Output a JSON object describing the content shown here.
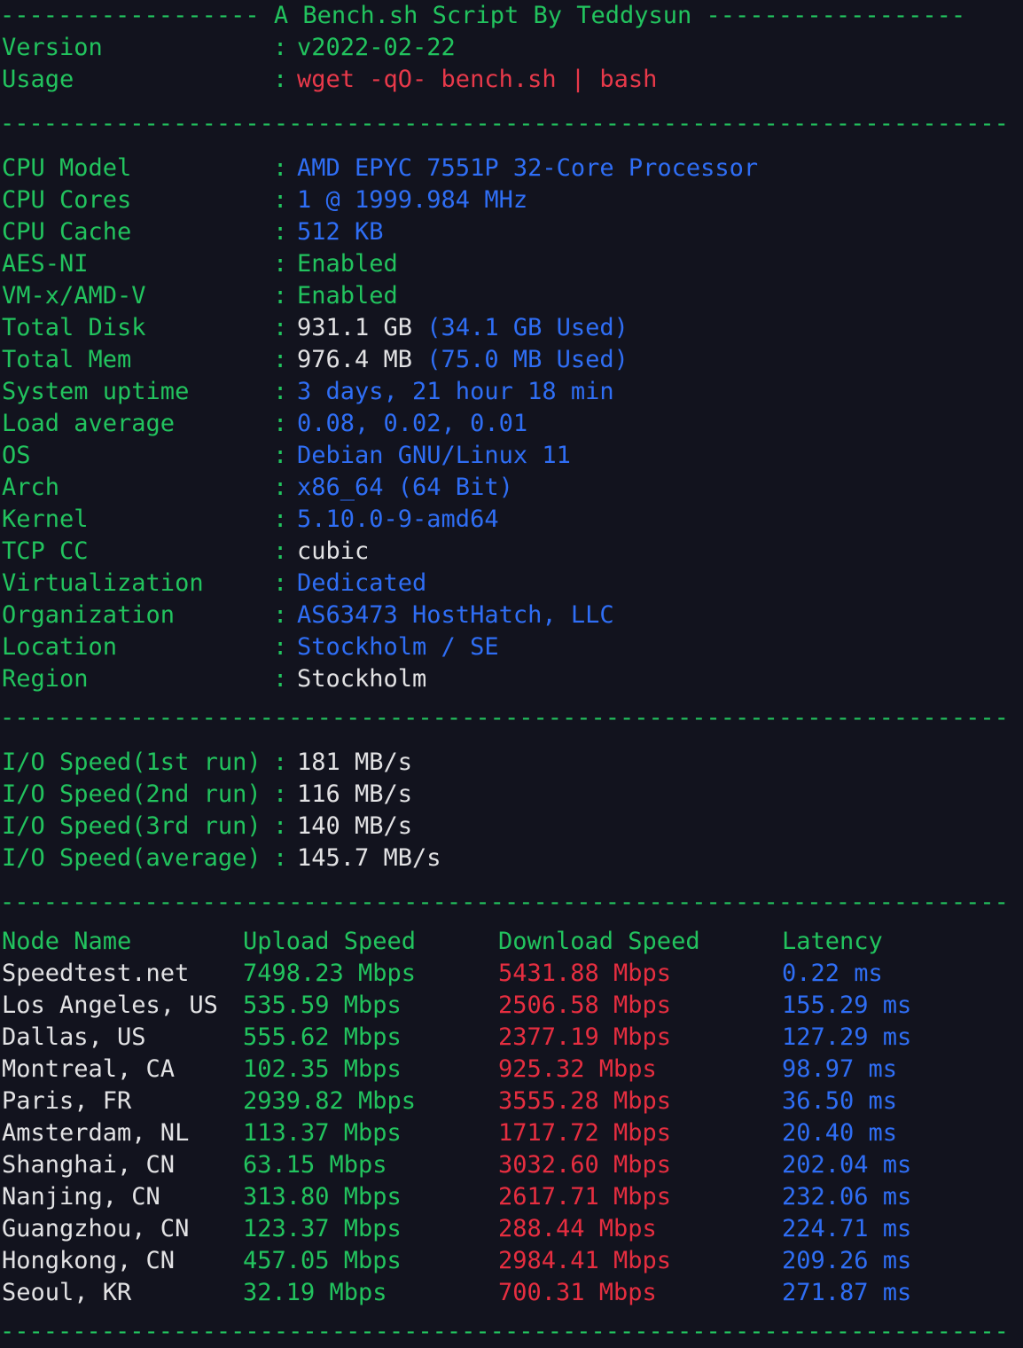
{
  "header": {
    "dashes_left": "------------------",
    "title": " A Bench.sh Script By Teddysun ",
    "dashes_right": "------------------",
    "separator": "----------------------------------------------------------------------",
    "rows": [
      {
        "label": "Version",
        "colon": ":",
        "value": "v2022-02-22",
        "value_color": "green"
      },
      {
        "label": "Usage",
        "colon": ":",
        "value": "wget -qO- bench.sh | bash",
        "value_color": "red-lt"
      }
    ]
  },
  "system": {
    "rows": [
      {
        "label": "CPU Model",
        "colon": ":",
        "value": "AMD EPYC 7551P 32-Core Processor",
        "value_color": "blue"
      },
      {
        "label": "CPU Cores",
        "colon": ":",
        "value": "1 @ 1999.984 MHz",
        "value_color": "blue"
      },
      {
        "label": "CPU Cache",
        "colon": ":",
        "value": "512 KB",
        "value_color": "blue"
      },
      {
        "label": "AES-NI",
        "colon": ":",
        "value": "Enabled",
        "value_color": "green"
      },
      {
        "label": "VM-x/AMD-V",
        "colon": ":",
        "value": "Enabled",
        "value_color": "green"
      },
      {
        "label": "Total Disk",
        "colon": ":",
        "value": "931.1 GB",
        "value_color": "white",
        "extra": "(34.1 GB Used)",
        "extra_color": "blue"
      },
      {
        "label": "Total Mem",
        "colon": ":",
        "value": "976.4 MB",
        "value_color": "white",
        "extra": "(75.0 MB Used)",
        "extra_color": "blue"
      },
      {
        "label": "System uptime",
        "colon": ":",
        "value": "3 days, 21 hour 18 min",
        "value_color": "blue"
      },
      {
        "label": "Load average",
        "colon": ":",
        "value": "0.08, 0.02, 0.01",
        "value_color": "blue"
      },
      {
        "label": "OS",
        "colon": ":",
        "value": "Debian GNU/Linux 11",
        "value_color": "blue"
      },
      {
        "label": "Arch",
        "colon": ":",
        "value": "x86_64 (64 Bit)",
        "value_color": "blue"
      },
      {
        "label": "Kernel",
        "colon": ":",
        "value": "5.10.0-9-amd64",
        "value_color": "blue"
      },
      {
        "label": "TCP CC",
        "colon": ":",
        "value": "cubic",
        "value_color": "white"
      },
      {
        "label": "Virtualization",
        "colon": ":",
        "value": "Dedicated",
        "value_color": "blue"
      },
      {
        "label": "Organization",
        "colon": ":",
        "value": "AS63473 HostHatch, LLC",
        "value_color": "blue"
      },
      {
        "label": "Location",
        "colon": ":",
        "value": "Stockholm / SE",
        "value_color": "blue"
      },
      {
        "label": "Region",
        "colon": ":",
        "value": "Stockholm",
        "value_color": "white"
      }
    ]
  },
  "io": {
    "rows": [
      {
        "label": "I/O Speed(1st run)",
        "colon": ":",
        "value": "181 MB/s",
        "value_color": "white"
      },
      {
        "label": "I/O Speed(2nd run)",
        "colon": ":",
        "value": "116 MB/s",
        "value_color": "white"
      },
      {
        "label": "I/O Speed(3rd run)",
        "colon": ":",
        "value": "140 MB/s",
        "value_color": "white"
      },
      {
        "label": "I/O Speed(average)",
        "colon": ":",
        "value": "145.7 MB/s",
        "value_color": "white"
      }
    ]
  },
  "speedtest": {
    "columns": {
      "node": "Node Name",
      "upload": "Upload Speed",
      "download": "Download Speed",
      "latency": "Latency"
    },
    "rows": [
      {
        "node": "Speedtest.net",
        "upload": "7498.23 Mbps",
        "download": "5431.88 Mbps",
        "latency": "0.22 ms"
      },
      {
        "node": "Los Angeles, US",
        "upload": "535.59 Mbps",
        "download": "2506.58 Mbps",
        "latency": "155.29 ms"
      },
      {
        "node": "Dallas, US",
        "upload": "555.62 Mbps",
        "download": "2377.19 Mbps",
        "latency": "127.29 ms"
      },
      {
        "node": "Montreal, CA",
        "upload": "102.35 Mbps",
        "download": "925.32 Mbps",
        "latency": "98.97 ms"
      },
      {
        "node": "Paris, FR",
        "upload": "2939.82 Mbps",
        "download": "3555.28 Mbps",
        "latency": "36.50 ms"
      },
      {
        "node": "Amsterdam, NL",
        "upload": "113.37 Mbps",
        "download": "1717.72 Mbps",
        "latency": "20.40 ms"
      },
      {
        "node": "Shanghai, CN",
        "upload": "63.15 Mbps",
        "download": "3032.60 Mbps",
        "latency": "202.04 ms"
      },
      {
        "node": "Nanjing, CN",
        "upload": "313.80 Mbps",
        "download": "2617.71 Mbps",
        "latency": "232.06 ms"
      },
      {
        "node": "Guangzhou, CN",
        "upload": "123.37 Mbps",
        "download": "288.44 Mbps",
        "latency": "224.71 ms"
      },
      {
        "node": "Hongkong, CN",
        "upload": "457.05 Mbps",
        "download": "2984.41 Mbps",
        "latency": "209.26 ms"
      },
      {
        "node": "Seoul, KR",
        "upload": "32.19 Mbps",
        "download": "700.31 Mbps",
        "latency": "271.87 ms"
      }
    ]
  },
  "colors": {
    "background": "#12131e",
    "green": "#22c35e",
    "red": "#e62e40",
    "red_light": "#e8394a",
    "blue": "#2f6ef5",
    "white": "#e2e2e4"
  }
}
